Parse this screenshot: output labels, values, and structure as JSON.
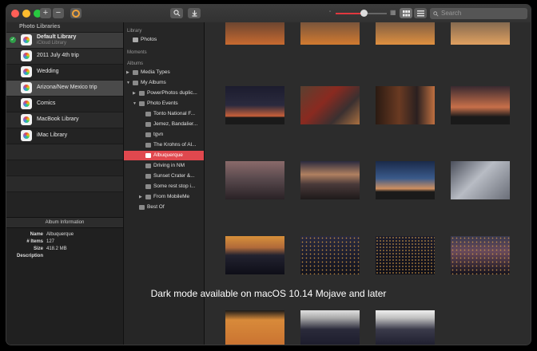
{
  "toolbar": {
    "add_label": "+",
    "remove_label": "−",
    "zoom_value": 0.55,
    "search_placeholder": "Search"
  },
  "libraries": {
    "header": "Photo Libraries",
    "items": [
      {
        "name": "Default Library",
        "subtitle": "iCloud Library",
        "active": true
      },
      {
        "name": "2011 July 4th trip"
      },
      {
        "name": "Wedding"
      },
      {
        "name": "Arizona/New Mexico trip"
      },
      {
        "name": "Comics"
      },
      {
        "name": "MacBook Library"
      },
      {
        "name": "iMac Library"
      }
    ]
  },
  "album_info": {
    "header": "Album Information",
    "name_label": "Name",
    "name_value": "Albuquerque",
    "items_label": "# Items",
    "items_value": "127",
    "size_label": "Size",
    "size_value": "418.2 MB",
    "description_label": "Description"
  },
  "sidebar": {
    "library_section": "Library",
    "photos": "Photos",
    "moments_section": "Moments",
    "albums_section": "Albums",
    "media_types": "Media Types",
    "my_albums": "My Albums",
    "powerphotos": "PowerPhotos duplic...",
    "photo_events": "Photo Events",
    "events": [
      "Tonto National F...",
      "Jemez, Bandalier...",
      "tgvn",
      "The Krohns of Al...",
      "Albuquerque",
      "Driving in NM",
      "Sunset Crater &...",
      "Some rest stop i..."
    ],
    "from_mobileme": "From MobileMe",
    "best_of": "Best Of"
  },
  "banner": "Dark mode available on macOS 10.14 Mojave and later",
  "colors": {
    "selection": "#e0484e",
    "accent_red": "#e0383e",
    "check_green": "#2e9e48"
  }
}
